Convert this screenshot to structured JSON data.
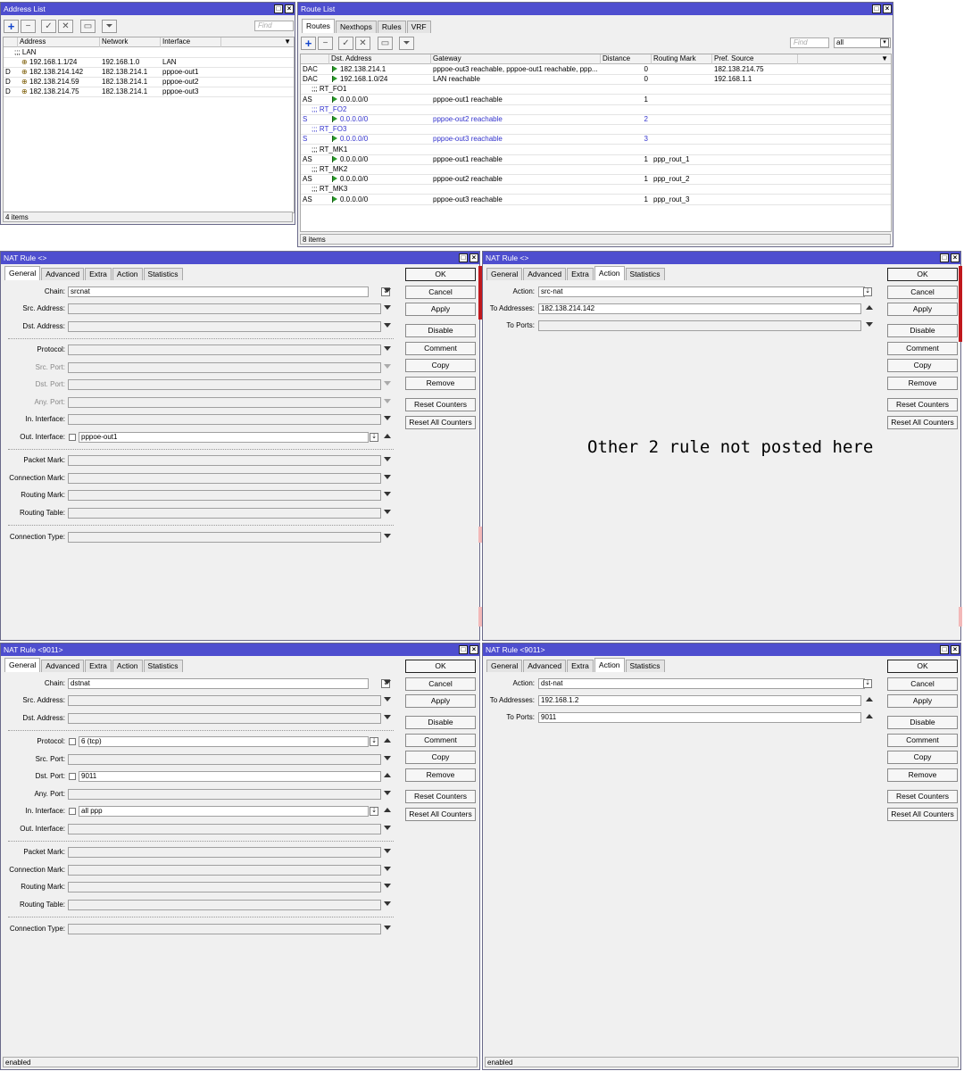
{
  "address_list": {
    "title": "Address List",
    "find_placeholder": "Find",
    "columns": [
      "Address",
      "Network",
      "Interface",
      ""
    ],
    "comment": ";;; LAN",
    "rows": [
      {
        "flag": "",
        "address": "192.168.1.1/24",
        "network": "192.168.1.0",
        "interface": "LAN"
      },
      {
        "flag": "D",
        "address": "182.138.214.142",
        "network": "182.138.214.1",
        "interface": "pppoe-out1"
      },
      {
        "flag": "D",
        "address": "182.138.214.59",
        "network": "182.138.214.1",
        "interface": "pppoe-out2"
      },
      {
        "flag": "D",
        "address": "182.138.214.75",
        "network": "182.138.214.1",
        "interface": "pppoe-out3"
      }
    ],
    "status": "4 items"
  },
  "route_list": {
    "title": "Route List",
    "tabs": [
      "Routes",
      "Nexthops",
      "Rules",
      "VRF"
    ],
    "find_placeholder": "Find",
    "filter_value": "all",
    "columns": [
      "",
      "Dst. Address",
      "Gateway",
      "Distance",
      "Routing Mark",
      "Pref. Source",
      ""
    ],
    "rows": [
      {
        "kind": "row",
        "flag": "DAC",
        "dst": "182.138.214.1",
        "gateway": "pppoe-out3 reachable, pppoe-out1 reachable, ppp...",
        "distance": "0",
        "mark": "",
        "pref": "182.138.214.75"
      },
      {
        "kind": "row",
        "flag": "DAC",
        "dst": "192.168.1.0/24",
        "gateway": "LAN reachable",
        "distance": "0",
        "mark": "",
        "pref": "192.168.1.1"
      },
      {
        "kind": "comment",
        "text": ";;; RT_FO1"
      },
      {
        "kind": "row",
        "flag": "AS",
        "dst": "0.0.0.0/0",
        "gateway": "pppoe-out1 reachable",
        "distance": "1",
        "mark": "",
        "pref": ""
      },
      {
        "kind": "comment",
        "text": ";;; RT_FO2",
        "blue": true
      },
      {
        "kind": "row",
        "flag": "S",
        "dst": "0.0.0.0/0",
        "gateway": "pppoe-out2 reachable",
        "distance": "2",
        "mark": "",
        "pref": "",
        "blue": true
      },
      {
        "kind": "comment",
        "text": ";;; RT_FO3",
        "blue": true
      },
      {
        "kind": "row",
        "flag": "S",
        "dst": "0.0.0.0/0",
        "gateway": "pppoe-out3 reachable",
        "distance": "3",
        "mark": "",
        "pref": "",
        "blue": true
      },
      {
        "kind": "comment",
        "text": ";;; RT_MK1"
      },
      {
        "kind": "row",
        "flag": "AS",
        "dst": "0.0.0.0/0",
        "gateway": "pppoe-out1 reachable",
        "distance": "1",
        "mark": "ppp_rout_1",
        "pref": ""
      },
      {
        "kind": "comment",
        "text": ";;; RT_MK2"
      },
      {
        "kind": "row",
        "flag": "AS",
        "dst": "0.0.0.0/0",
        "gateway": "pppoe-out2 reachable",
        "distance": "1",
        "mark": "ppp_rout_2",
        "pref": ""
      },
      {
        "kind": "comment",
        "text": ";;; RT_MK3"
      },
      {
        "kind": "row",
        "flag": "AS",
        "dst": "0.0.0.0/0",
        "gateway": "pppoe-out3 reachable",
        "distance": "1",
        "mark": "ppp_rout_3",
        "pref": ""
      }
    ],
    "status": "8 items"
  },
  "nat1_general": {
    "title": "NAT Rule <>",
    "tabs": [
      "General",
      "Advanced",
      "Extra",
      "Action",
      "Statistics"
    ],
    "chain": "srcnat",
    "labels": {
      "chain": "Chain:",
      "src_address": "Src. Address:",
      "dst_address": "Dst. Address:",
      "protocol": "Protocol:",
      "src_port": "Src. Port:",
      "dst_port": "Dst. Port:",
      "any_port": "Any. Port:",
      "in_interface": "In. Interface:",
      "out_interface": "Out. Interface:",
      "packet_mark": "Packet Mark:",
      "connection_mark": "Connection Mark:",
      "routing_mark": "Routing Mark:",
      "routing_table": "Routing Table:",
      "connection_type": "Connection Type:"
    },
    "out_interface": "pppoe-out1"
  },
  "nat1_action": {
    "title": "NAT Rule <>",
    "tabs": [
      "General",
      "Advanced",
      "Extra",
      "Action",
      "Statistics"
    ],
    "labels": {
      "action": "Action:",
      "to_addresses": "To Addresses:",
      "to_ports": "To Ports:"
    },
    "action": "src-nat",
    "to_addresses": "182.138.214.142",
    "to_ports": ""
  },
  "nat2_general": {
    "title": "NAT Rule <9011>",
    "tabs": [
      "General",
      "Advanced",
      "Extra",
      "Action",
      "Statistics"
    ],
    "chain": "dstnat",
    "protocol": "6 (tcp)",
    "dst_port": "9011",
    "in_interface": "all ppp",
    "status": "enabled"
  },
  "nat2_action": {
    "title": "NAT Rule <9011>",
    "tabs": [
      "General",
      "Advanced",
      "Extra",
      "Action",
      "Statistics"
    ],
    "action": "dst-nat",
    "to_addresses": "192.168.1.2",
    "to_ports": "9011",
    "status": "enabled"
  },
  "buttons": {
    "ok": "OK",
    "cancel": "Cancel",
    "apply": "Apply",
    "disable": "Disable",
    "comment": "Comment",
    "copy": "Copy",
    "remove": "Remove",
    "reset_counters": "Reset Counters",
    "reset_all_counters": "Reset All Counters"
  },
  "annotation": "Other 2 rule not posted here",
  "colors": {
    "titlebar": "#4e4ecf",
    "accent_blue": "#3333cc",
    "flag_green": "#2a9a2a"
  },
  "icons": {
    "add": "plus-icon",
    "remove": "minus-icon",
    "enable": "check-icon",
    "disable": "x-icon",
    "comment": "comment-icon",
    "filter": "filter-icon",
    "route_flag": "flag-icon",
    "address_flag": "address-icon"
  }
}
